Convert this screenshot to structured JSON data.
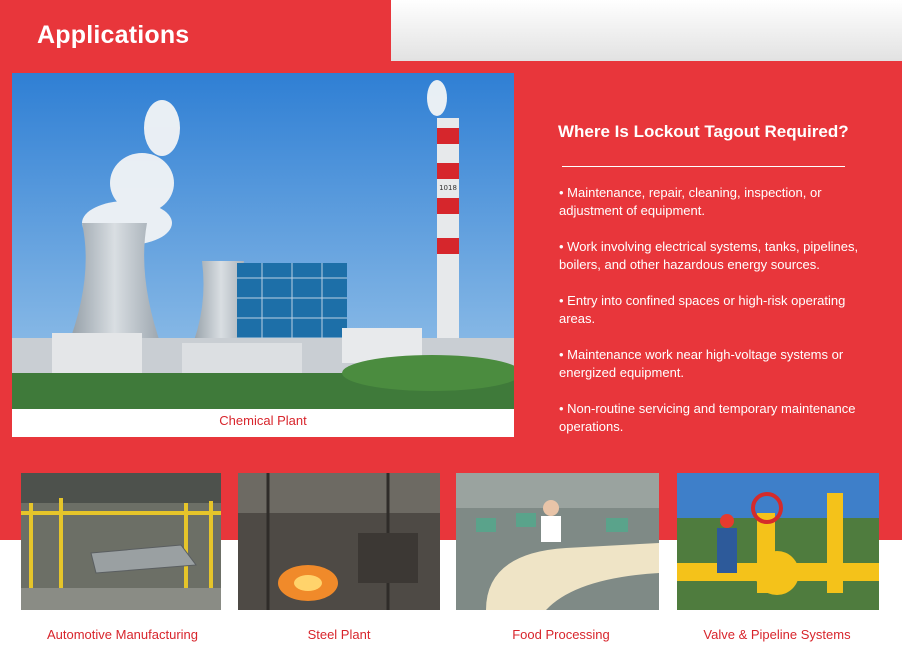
{
  "page": {
    "title": "Applications"
  },
  "hero": {
    "caption": "Chemical Plant",
    "image_icon": "cooling-tower-plant-photo",
    "chimney_label": "1018"
  },
  "panel": {
    "title": "Where Is Lockout Tagout Required?",
    "bullets": [
      "• Maintenance, repair, cleaning, inspection, or adjustment of equipment.",
      "• Work involving electrical systems, tanks, pipelines, boilers, and other hazardous energy sources.",
      "• Entry into confined spaces or high-risk operating areas.",
      "• Maintenance work near high-voltage systems or energized equipment.",
      "• Non-routine servicing and temporary maintenance operations."
    ]
  },
  "thumbnails": [
    {
      "caption": "Automotive Manufacturing",
      "image_icon": "car-assembly-line-photo"
    },
    {
      "caption": "Steel Plant",
      "image_icon": "steel-mill-photo"
    },
    {
      "caption": "Food Processing",
      "image_icon": "food-conveyor-photo"
    },
    {
      "caption": "Valve & Pipeline Systems",
      "image_icon": "yellow-valve-pipeline-photo"
    }
  ],
  "colors": {
    "brand_red": "#e8363b",
    "caption_red": "#d8252c",
    "text_white": "#ffffff"
  }
}
